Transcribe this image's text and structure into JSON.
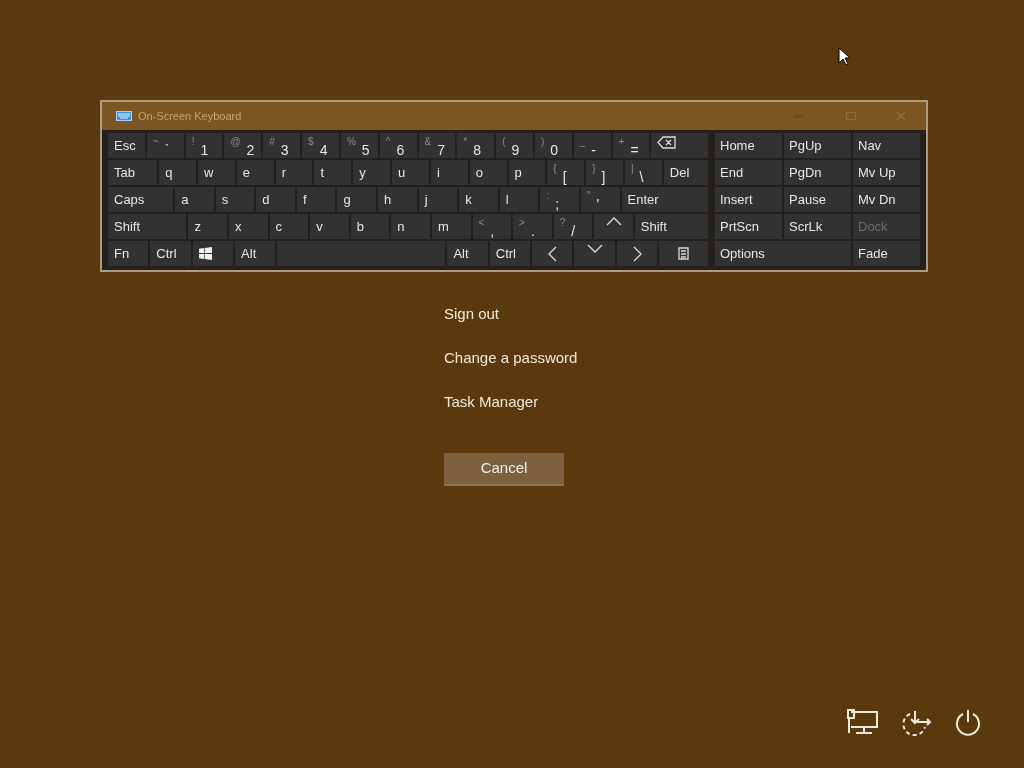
{
  "osk": {
    "title": "On-Screen Keyboard",
    "main_rows": [
      [
        {
          "kind": "text",
          "label": "Esc"
        },
        {
          "kind": "char",
          "shift": "~",
          "label": "`"
        },
        {
          "kind": "char",
          "shift": "!",
          "label": "1"
        },
        {
          "kind": "char",
          "shift": "@",
          "label": "2"
        },
        {
          "kind": "char",
          "shift": "#",
          "label": "3"
        },
        {
          "kind": "char",
          "shift": "$",
          "label": "4"
        },
        {
          "kind": "char",
          "shift": "%",
          "label": "5"
        },
        {
          "kind": "char",
          "shift": "^",
          "label": "6"
        },
        {
          "kind": "char",
          "shift": "&",
          "label": "7"
        },
        {
          "kind": "char",
          "shift": "*",
          "label": "8"
        },
        {
          "kind": "char",
          "shift": "(",
          "label": "9"
        },
        {
          "kind": "char",
          "shift": ")",
          "label": "0"
        },
        {
          "kind": "char",
          "shift": "_",
          "label": "-"
        },
        {
          "kind": "char",
          "shift": "+",
          "label": "="
        },
        {
          "kind": "backspace"
        }
      ],
      [
        {
          "kind": "text",
          "label": "Tab"
        },
        {
          "kind": "text",
          "label": "q"
        },
        {
          "kind": "text",
          "label": "w"
        },
        {
          "kind": "text",
          "label": "e"
        },
        {
          "kind": "text",
          "label": "r"
        },
        {
          "kind": "text",
          "label": "t"
        },
        {
          "kind": "text",
          "label": "y"
        },
        {
          "kind": "text",
          "label": "u"
        },
        {
          "kind": "text",
          "label": "i"
        },
        {
          "kind": "text",
          "label": "o"
        },
        {
          "kind": "text",
          "label": "p"
        },
        {
          "kind": "char",
          "shift": "{",
          "label": "["
        },
        {
          "kind": "char",
          "shift": "}",
          "label": "]"
        },
        {
          "kind": "char",
          "shift": "|",
          "label": "\\"
        },
        {
          "kind": "text",
          "label": "Del"
        }
      ],
      [
        {
          "kind": "text",
          "label": "Caps"
        },
        {
          "kind": "text",
          "label": "a"
        },
        {
          "kind": "text",
          "label": "s"
        },
        {
          "kind": "text",
          "label": "d"
        },
        {
          "kind": "text",
          "label": "f"
        },
        {
          "kind": "text",
          "label": "g"
        },
        {
          "kind": "text",
          "label": "h"
        },
        {
          "kind": "text",
          "label": "j"
        },
        {
          "kind": "text",
          "label": "k"
        },
        {
          "kind": "text",
          "label": "l"
        },
        {
          "kind": "char",
          "shift": ":",
          "label": ";"
        },
        {
          "kind": "char",
          "shift": "\"",
          "label": "'"
        },
        {
          "kind": "text",
          "label": "Enter"
        }
      ],
      [
        {
          "kind": "text",
          "label": "Shift"
        },
        {
          "kind": "text",
          "label": "z"
        },
        {
          "kind": "text",
          "label": "x"
        },
        {
          "kind": "text",
          "label": "c"
        },
        {
          "kind": "text",
          "label": "v"
        },
        {
          "kind": "text",
          "label": "b"
        },
        {
          "kind": "text",
          "label": "n"
        },
        {
          "kind": "text",
          "label": "m"
        },
        {
          "kind": "char",
          "shift": "<",
          "label": ","
        },
        {
          "kind": "char",
          "shift": ">",
          "label": "."
        },
        {
          "kind": "char",
          "shift": "?",
          "label": "/"
        },
        {
          "kind": "up"
        },
        {
          "kind": "text",
          "label": "Shift"
        }
      ],
      [
        {
          "kind": "text",
          "label": "Fn"
        },
        {
          "kind": "text",
          "label": "Ctrl"
        },
        {
          "kind": "windows"
        },
        {
          "kind": "text",
          "label": "Alt"
        },
        {
          "kind": "space"
        },
        {
          "kind": "text",
          "label": "Alt"
        },
        {
          "kind": "text",
          "label": "Ctrl"
        },
        {
          "kind": "left"
        },
        {
          "kind": "down"
        },
        {
          "kind": "right"
        },
        {
          "kind": "menu"
        }
      ]
    ],
    "nav_keys": [
      {
        "label": "Home",
        "disabled": false
      },
      {
        "label": "PgUp",
        "disabled": false
      },
      {
        "label": "Nav",
        "disabled": false
      },
      {
        "label": "End",
        "disabled": false
      },
      {
        "label": "PgDn",
        "disabled": false
      },
      {
        "label": "Mv Up",
        "disabled": false
      },
      {
        "label": "Insert",
        "disabled": false
      },
      {
        "label": "Pause",
        "disabled": false
      },
      {
        "label": "Mv Dn",
        "disabled": false
      },
      {
        "label": "PrtScn",
        "disabled": false
      },
      {
        "label": "ScrLk",
        "disabled": false
      },
      {
        "label": "Dock",
        "disabled": true
      },
      {
        "label": "Options",
        "disabled": false
      },
      {
        "label": "Fade",
        "disabled": false
      }
    ]
  },
  "menu": [
    "Sign out",
    "Change a password",
    "Task Manager"
  ],
  "cancel": "Cancel"
}
